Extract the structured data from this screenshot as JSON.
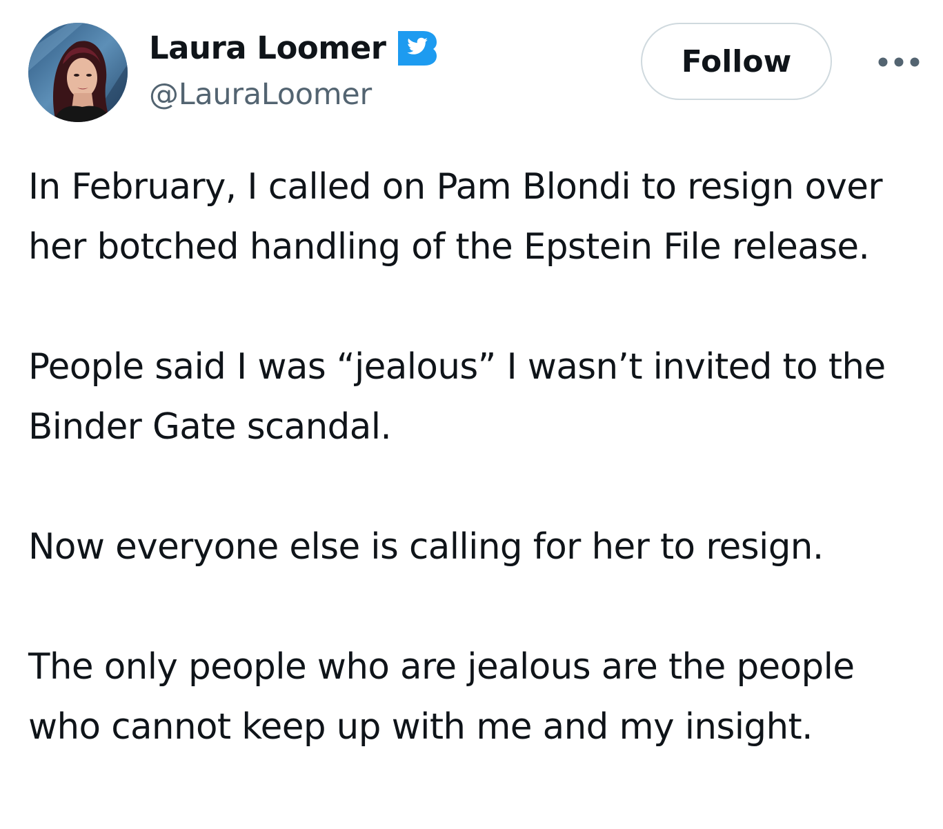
{
  "author": {
    "display_name": "Laura Loomer",
    "handle": "@LauraLoomer",
    "verified_badge_icon": "twitter-bird-badge-icon",
    "avatar_alt": "profile photo"
  },
  "actions": {
    "follow_label": "Follow",
    "more_icon": "more-horizontal-icon"
  },
  "tweet": {
    "paragraphs": [
      "In February, I called on Pam Blondi to resign over her botched handling of the Epstein File release.",
      "People said I was “jealous” I wasn’t invited to the Binder Gate scandal.",
      "Now everyone else is calling for her to resign.",
      "The only people who are jealous are the people who cannot keep up with me and my insight."
    ]
  },
  "colors": {
    "text_primary": "#0f1419",
    "text_secondary": "#536471",
    "badge_blue": "#1d9bf0",
    "button_border": "#cfd9de"
  }
}
